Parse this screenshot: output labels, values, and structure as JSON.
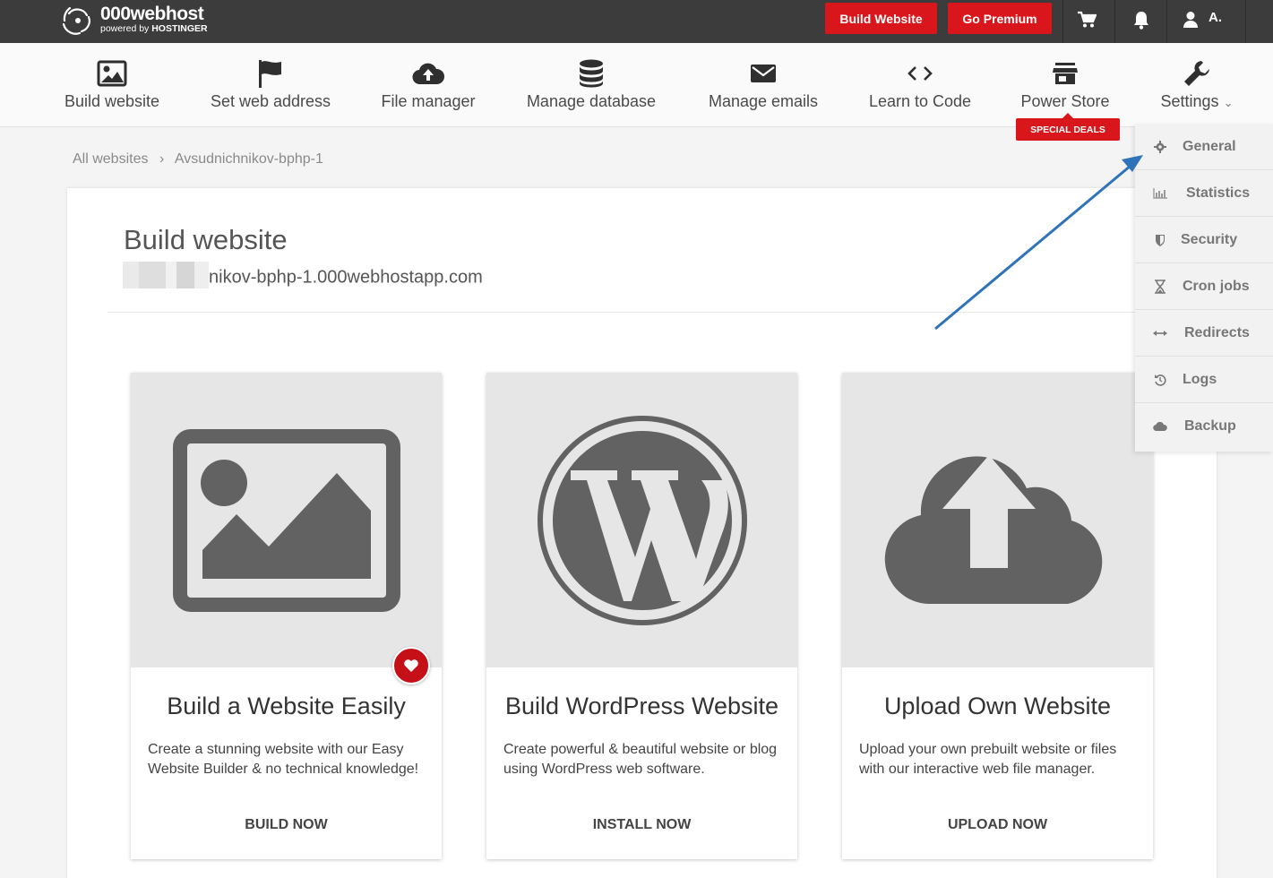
{
  "brand": {
    "name": "000webhost",
    "powered_prefix": "powered by ",
    "powered_brand": "HOSTINGER"
  },
  "topbar": {
    "build_website": "Build Website",
    "go_premium": "Go Premium",
    "user": "A.",
    "icons": [
      "cart-icon",
      "bell-icon",
      "user-icon"
    ],
    "accent": "#d8161b"
  },
  "nav": {
    "items": [
      {
        "label": "Build website",
        "icon": "image-icon"
      },
      {
        "label": "Set web address",
        "icon": "flag-icon"
      },
      {
        "label": "File manager",
        "icon": "cloud-upload-icon"
      },
      {
        "label": "Manage database",
        "icon": "database-icon"
      },
      {
        "label": "Manage emails",
        "icon": "envelope-icon"
      },
      {
        "label": "Learn to Code",
        "icon": "code-icon"
      },
      {
        "label": "Power Store",
        "icon": "store-icon"
      },
      {
        "label": "Settings",
        "icon": "wrench-icon",
        "caret": "⌄"
      }
    ],
    "special_deals": "SPECIAL DEALS"
  },
  "breadcrumb": {
    "root": "All websites",
    "separator": "›",
    "current": "Avsudnichnikov-bphp-1"
  },
  "main": {
    "title": "Build website",
    "url_visible": "nikov-bphp-1.000webhostapp.com",
    "cards": [
      {
        "title": "Build a Website Easily",
        "description": "Create a stunning website with our Easy Website Builder & no technical knowledge!",
        "action": "BUILD NOW",
        "icon": "image-icon"
      },
      {
        "title": "Build WordPress Website",
        "description": "Create powerful & beautiful website or blog using WordPress web software.",
        "action": "INSTALL NOW",
        "icon": "wordpress-icon"
      },
      {
        "title": "Upload Own Website",
        "description": "Upload your own prebuilt website or files with our interactive web file manager.",
        "action": "UPLOAD NOW",
        "icon": "cloud-upload-icon"
      }
    ]
  },
  "settings_menu": [
    {
      "label": "General",
      "icon": "gear-icon"
    },
    {
      "label": "Statistics",
      "icon": "bar-chart-icon"
    },
    {
      "label": "Security",
      "icon": "shield-icon"
    },
    {
      "label": "Cron jobs",
      "icon": "hourglass-icon"
    },
    {
      "label": "Redirects",
      "icon": "arrows-horizontal-icon"
    },
    {
      "label": "Logs",
      "icon": "history-icon"
    },
    {
      "label": "Backup",
      "icon": "cloud-icon"
    }
  ]
}
